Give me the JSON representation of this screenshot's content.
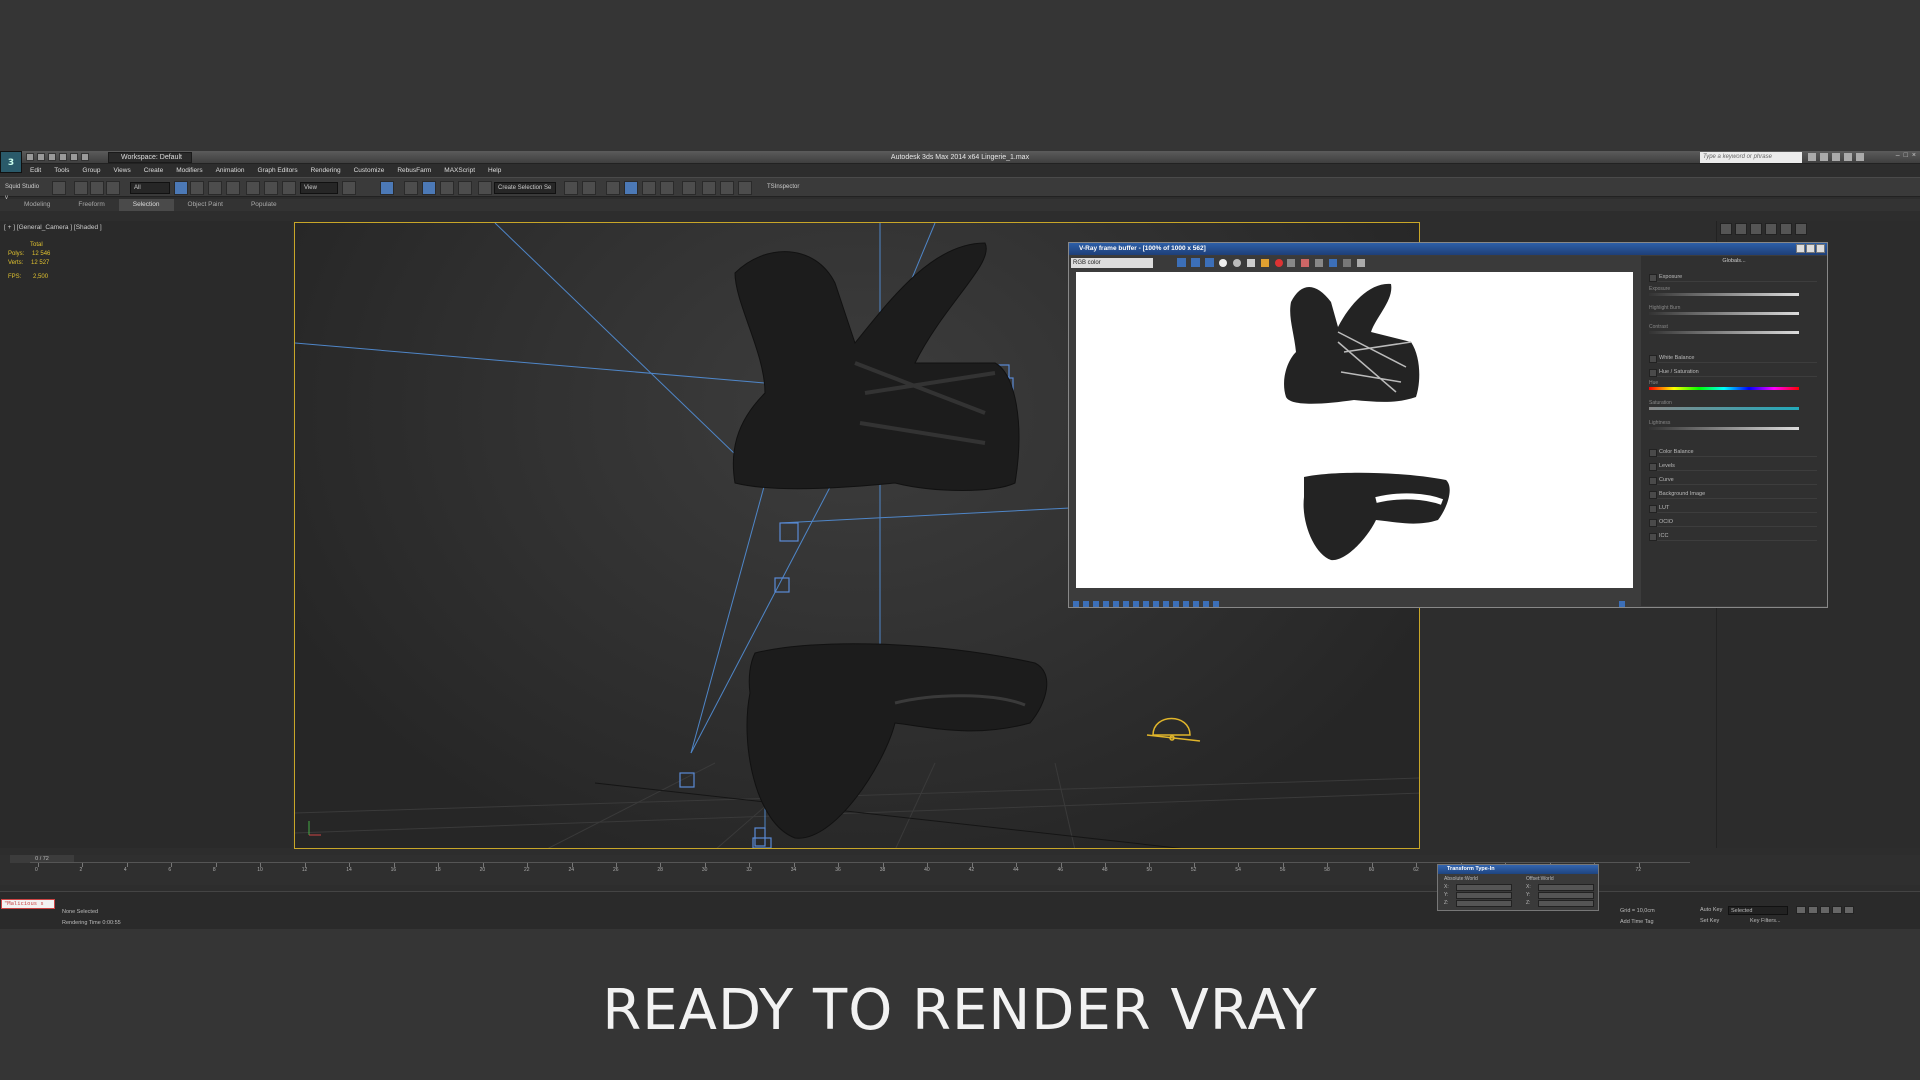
{
  "app": {
    "window_title": "Autodesk 3ds Max  2014 x64     Lingerie_1.max",
    "workspace": "Workspace: Default",
    "keyword_placeholder": "Type a keyword or phrase",
    "squid": "Squid Studio v",
    "menus": [
      "Edit",
      "Tools",
      "Group",
      "Views",
      "Create",
      "Modifiers",
      "Animation",
      "Graph Editors",
      "Rendering",
      "Customize",
      "RebusFarm",
      "MAXScript",
      "Help"
    ],
    "toolbar": {
      "filter": "All",
      "view": "View",
      "selection_set": "Create Selection Se",
      "tsinspector": "TSInspector"
    },
    "ribbon_tabs": [
      "Modeling",
      "Freeform",
      "Selection",
      "Object Paint",
      "Populate"
    ],
    "ribbon_active": "Selection"
  },
  "viewport": {
    "label": "[ + ] [General_Camera ] [Shaded ]",
    "stats": {
      "header": "Total",
      "polys_label": "Polys:",
      "polys": "12 546",
      "verts_label": "Verts:",
      "verts": "12 527",
      "fps_label": "FPS:",
      "fps": "2,500"
    }
  },
  "vfb": {
    "title": "V-Ray frame buffer - [100% of 1000 x 562]",
    "channel": "RGB color",
    "panel_header": "Globals...",
    "exposure": "Exposure",
    "slider_labels": [
      "Exposure",
      "Highlight Burn",
      "Contrast"
    ],
    "white_balance": "White Balance",
    "hue_sat": "Hue / Saturation",
    "hue_labels": [
      "Hue",
      "Saturation",
      "Lightness"
    ],
    "layers": [
      "Color Balance",
      "Levels",
      "Curve",
      "Background Image",
      "LUT",
      "OCIO",
      "ICC"
    ]
  },
  "timeline": {
    "frame": "0 / 72",
    "ticks": [
      "0",
      "2",
      "4",
      "6",
      "8",
      "10",
      "12",
      "14",
      "16",
      "18",
      "20",
      "22",
      "24",
      "26",
      "28",
      "30",
      "32",
      "34",
      "36",
      "38",
      "40",
      "42",
      "44",
      "46",
      "48",
      "50",
      "52",
      "54",
      "56",
      "58",
      "60",
      "62",
      "64",
      "66",
      "68",
      "70",
      "72"
    ]
  },
  "status": {
    "maxscript": "\"Malicious s",
    "selection": "None Selected",
    "render_time": "Rendering Time  0:00:55",
    "grid": "Grid = 10,0cm",
    "autokey": "Auto Key",
    "selected": "Selected",
    "setkey": "Set Key",
    "key_filters": "Key Filters...",
    "add_time_tag": "Add Time Tag"
  },
  "transform": {
    "title": "Transform Type-In",
    "abs": "Absolute:World",
    "offset": "Offset:World",
    "axes": [
      "X:",
      "Y:",
      "Z:"
    ]
  },
  "caption": "READY TO RENDER  VRAY"
}
